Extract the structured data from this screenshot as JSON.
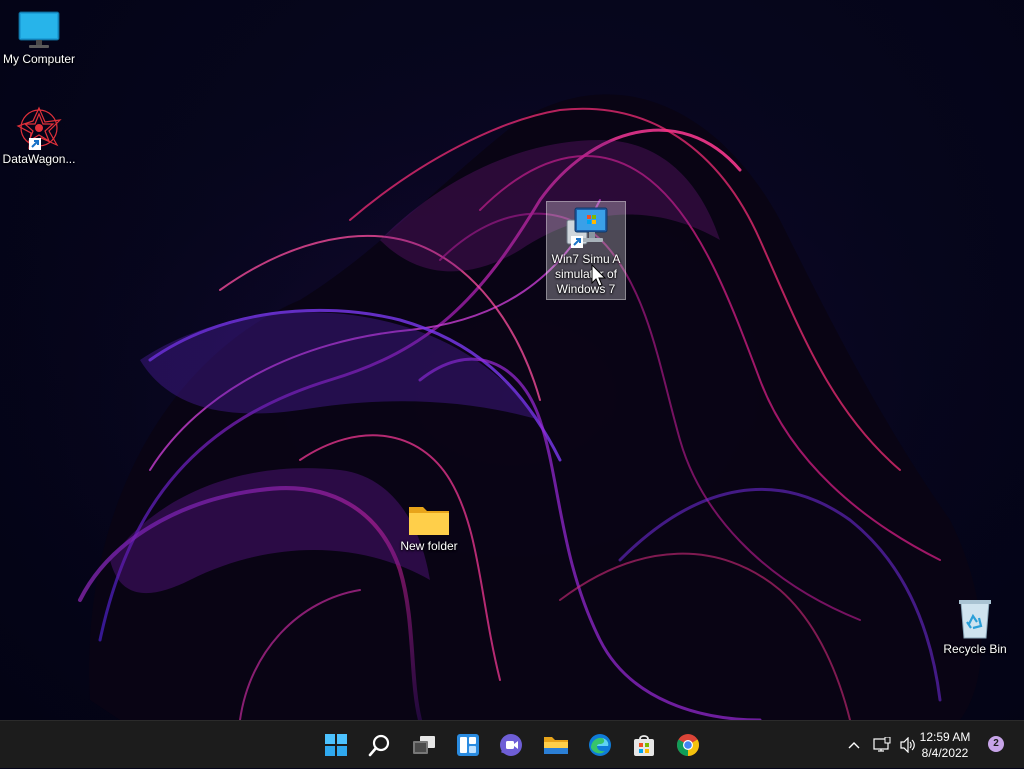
{
  "desktop": {
    "icons": [
      {
        "label": "My Computer"
      },
      {
        "label": "DataWagon..."
      },
      {
        "label": "Win7 Simu   A simulator of Windows 7"
      },
      {
        "label": "New folder"
      },
      {
        "label": "Recycle Bin"
      }
    ]
  },
  "taskbar": {
    "apps": [
      {
        "name": "start-icon"
      },
      {
        "name": "search-icon"
      },
      {
        "name": "task-view-icon"
      },
      {
        "name": "widgets-icon"
      },
      {
        "name": "teams-chat-icon"
      },
      {
        "name": "file-explorer-icon"
      },
      {
        "name": "edge-icon"
      },
      {
        "name": "store-icon"
      },
      {
        "name": "chrome-icon"
      }
    ],
    "tray": {
      "time": "12:59 AM",
      "date": "8/4/2022",
      "notification_count": "2"
    }
  },
  "colors": {
    "taskbar_bg": "#1c1c1c",
    "accent": "#0078d4",
    "wallpaper_magenta": "#d6258f",
    "wallpaper_violet": "#6b2fd0"
  }
}
